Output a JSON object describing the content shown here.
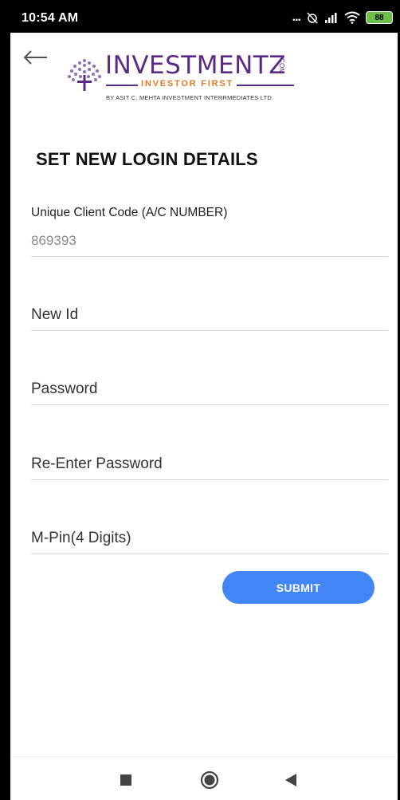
{
  "status_bar": {
    "time": "10:54 AM",
    "dots": "...",
    "battery": "88"
  },
  "logo": {
    "brand": "INVESTMENTZ",
    "com": ".COM",
    "tagline": "INVESTOR FIRST",
    "sub": "BY ASIT C. MEHTA INVESTMENT INTERRMEDIATES LTD."
  },
  "page_title": "SET NEW LOGIN DETAILS",
  "form": {
    "client_code_label": "Unique Client Code (A/C NUMBER)",
    "client_code_value": "869393",
    "new_id_placeholder": "New Id",
    "password_placeholder": "Password",
    "reenter_password_placeholder": "Re-Enter Password",
    "mpin_placeholder": "M-Pin(4 Digits)",
    "submit_label": "SUBMIT"
  },
  "colors": {
    "accent": "#4285f4",
    "brand": "#5b2a86",
    "tagline": "#e07b2a"
  },
  "icons": [
    "back-arrow-icon",
    "signal-icon",
    "wifi-icon",
    "battery-icon",
    "recents-icon",
    "home-icon",
    "back-icon"
  ]
}
